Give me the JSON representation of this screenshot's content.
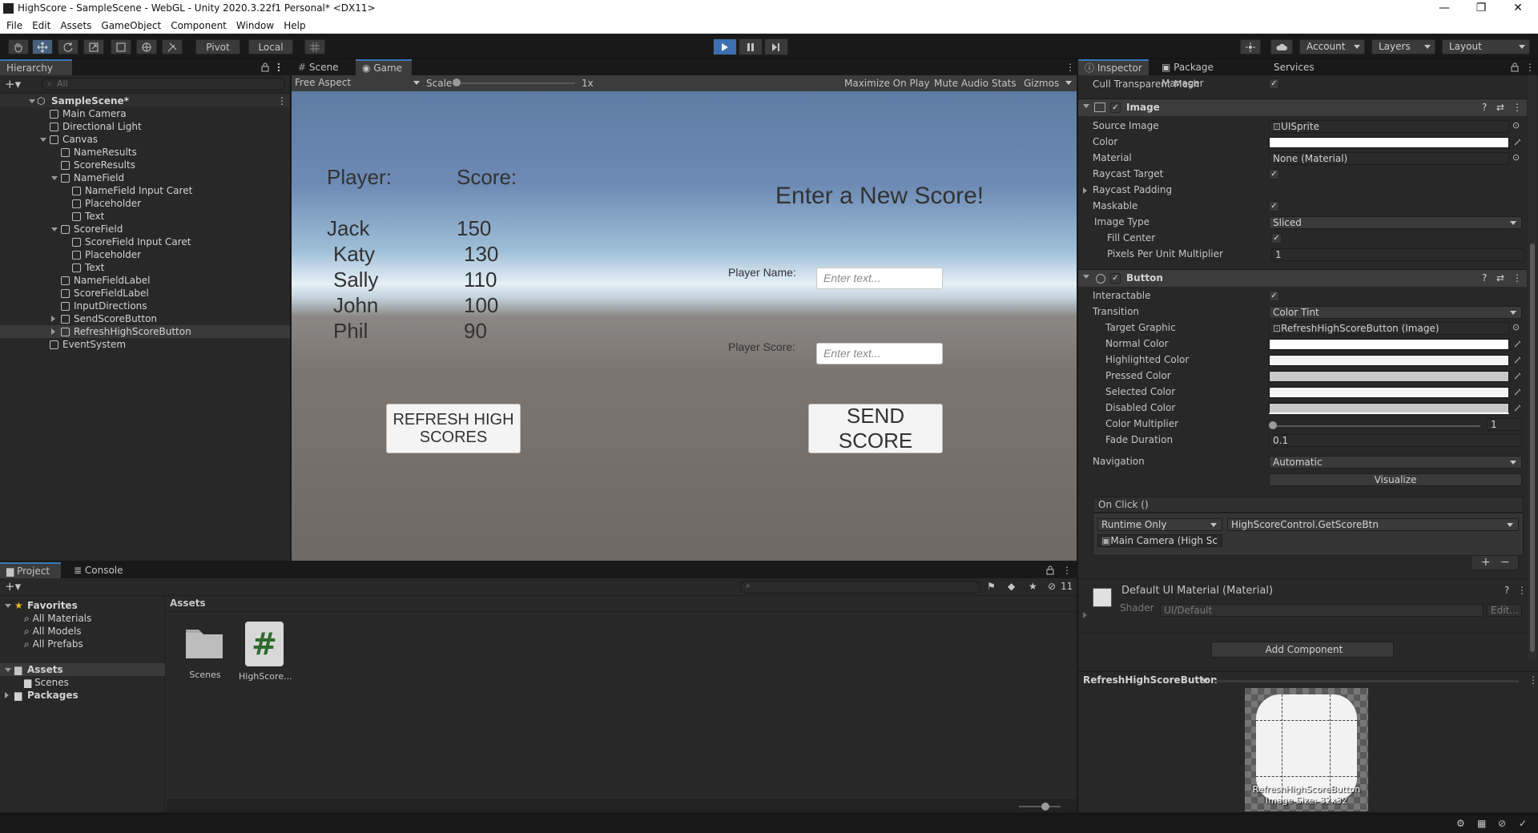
{
  "window": {
    "title": "HighScore - SampleScene - WebGL - Unity 2020.3.22f1 Personal* <DX11>",
    "controls": [
      "—",
      "❐",
      "✕"
    ]
  },
  "menu": [
    "File",
    "Edit",
    "Assets",
    "GameObject",
    "Component",
    "Window",
    "Help"
  ],
  "toolbar": {
    "pivot": "Pivot",
    "local": "Local",
    "account": "Account",
    "layers": "Layers",
    "layout": "Layout"
  },
  "hierarchy": {
    "tab": "Hierarchy",
    "search_placeholder": "All",
    "items": [
      {
        "label": "SampleScene*",
        "depth": 0
      },
      {
        "label": "Main Camera",
        "depth": 1
      },
      {
        "label": "Directional Light",
        "depth": 1
      },
      {
        "label": "Canvas",
        "depth": 1
      },
      {
        "label": "NameResults",
        "depth": 2
      },
      {
        "label": "ScoreResults",
        "depth": 2
      },
      {
        "label": "NameField",
        "depth": 2
      },
      {
        "label": "NameField Input Caret",
        "depth": 3
      },
      {
        "label": "Placeholder",
        "depth": 3
      },
      {
        "label": "Text",
        "depth": 3
      },
      {
        "label": "ScoreField",
        "depth": 2
      },
      {
        "label": "ScoreField Input Caret",
        "depth": 3
      },
      {
        "label": "Placeholder",
        "depth": 3
      },
      {
        "label": "Text",
        "depth": 3
      },
      {
        "label": "NameFieldLabel",
        "depth": 2
      },
      {
        "label": "ScoreFieldLabel",
        "depth": 2
      },
      {
        "label": "InputDirections",
        "depth": 2
      },
      {
        "label": "SendScoreButton",
        "depth": 2
      },
      {
        "label": "RefreshHighScoreButton",
        "depth": 2
      },
      {
        "label": "EventSystem",
        "depth": 1
      }
    ]
  },
  "scene_tabs": {
    "scene": "Scene",
    "game": "Game",
    "aspect": "Free Aspect",
    "scale_label": "Scale",
    "scale_value": "1x",
    "maximize": "Maximize On Play",
    "mute": "Mute Audio",
    "stats": "Stats",
    "gizmos": "Gizmos"
  },
  "game": {
    "player_header": "Player:",
    "score_header": "Score:",
    "names": [
      "Jack",
      "Katy",
      "Sally",
      "John",
      "Phil"
    ],
    "scores": [
      "150",
      "130",
      "110",
      "100",
      "90"
    ],
    "heading": "Enter a New Score!",
    "player_name_label": "Player Name:",
    "player_score_label": "Player Score:",
    "name_placeholder": "Enter text...",
    "score_placeholder": "Enter text...",
    "refresh_button": "REFRESH HIGH SCORES",
    "send_button": "SEND SCORE"
  },
  "inspector": {
    "tabs": [
      "Inspector",
      "Package Manager",
      "Services"
    ],
    "cull_label": "Cull Transparent Mesh",
    "image": {
      "title": "Image",
      "source_image_label": "Source Image",
      "source_image": "UISprite",
      "color_label": "Color",
      "material_label": "Material",
      "material": "None (Material)",
      "raycast_target": "Raycast Target",
      "raycast_padding": "Raycast Padding",
      "maskable": "Maskable",
      "image_type_label": "Image Type",
      "image_type": "Sliced",
      "fill_center": "Fill Center",
      "ppu_label": "Pixels Per Unit Multiplier",
      "ppu": "1"
    },
    "button": {
      "title": "Button",
      "interactable": "Interactable",
      "transition_label": "Transition",
      "transition": "Color Tint",
      "target_graphic_label": "Target Graphic",
      "target_graphic": "RefreshHighScoreButton (Image)",
      "normal": "Normal Color",
      "highlighted": "Highlighted Color",
      "pressed": "Pressed Color",
      "selected": "Selected Color",
      "disabled": "Disabled Color",
      "multiplier_label": "Color Multiplier",
      "multiplier": "1",
      "fade_label": "Fade Duration",
      "fade": "0.1",
      "navigation_label": "Navigation",
      "navigation": "Automatic",
      "visualize": "Visualize",
      "onclick": "On Click ()",
      "runtime": "Runtime Only",
      "function": "HighScoreControl.GetScoreBtn",
      "object": "Main Camera (High Sc"
    },
    "material_title": "Default UI Material (Material)",
    "shader_label": "Shader",
    "shader": "UI/Default",
    "shader_edit": "Edit...",
    "add_component": "Add Component",
    "preview_title": "RefreshHighScoreButton",
    "preview_name": "RefreshHighScoreButton",
    "preview_size": "Image Size: 32x32"
  },
  "project": {
    "tabs": [
      "Project",
      "Console"
    ],
    "favorites": "Favorites",
    "favorites_items": [
      "All Materials",
      "All Models",
      "All Prefabs"
    ],
    "assets": "Assets",
    "assets_children": [
      "Scenes"
    ],
    "packages": "Packages",
    "breadcrumb": "Assets",
    "hidden_count": "11",
    "files": [
      {
        "name": "Scenes",
        "kind": "folder"
      },
      {
        "name": "HighScore...",
        "kind": "script"
      }
    ]
  },
  "colors": {
    "accent": "#3a79bb",
    "play_active": "#3d6fb0",
    "panel": "#282828"
  }
}
